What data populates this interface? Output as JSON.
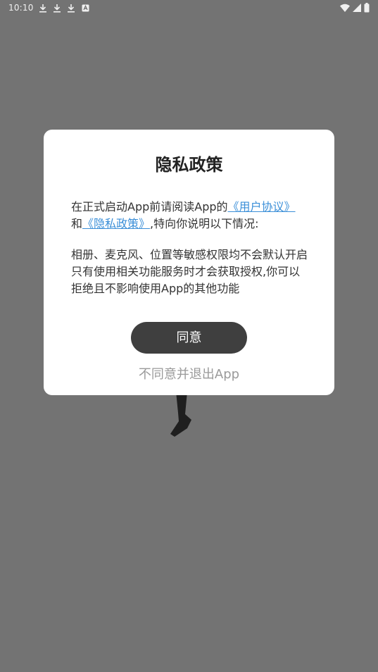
{
  "status_bar": {
    "time": "10:10",
    "left_icons": [
      "download-icon",
      "download-icon",
      "download-icon",
      "app-notification-icon"
    ],
    "right_icons": [
      "wifi-icon",
      "cellular-signal-icon",
      "battery-icon"
    ]
  },
  "dialog": {
    "title": "隐私政策",
    "intro_prefix": "在正式启动App前请阅读App的",
    "user_agreement_link": "《用户协议》",
    "conjunction": "和",
    "privacy_policy_link": "《隐私政策》",
    "intro_suffix": ",特向你说明以下情况:",
    "permissions_text": "相册、麦克风、位置等敏感权限均不会默认开启只有使用相关功能服务时才会获取授权,你可以拒绝且不影响使用App的其他功能",
    "agree_label": "同意",
    "disagree_label": "不同意并退出App"
  },
  "colors": {
    "overlay": "#737373",
    "dialog_bg": "#ffffff",
    "link": "#3b8fd8",
    "agree_button_bg": "#3f3f3f",
    "disagree_text": "#9a9a9a"
  }
}
